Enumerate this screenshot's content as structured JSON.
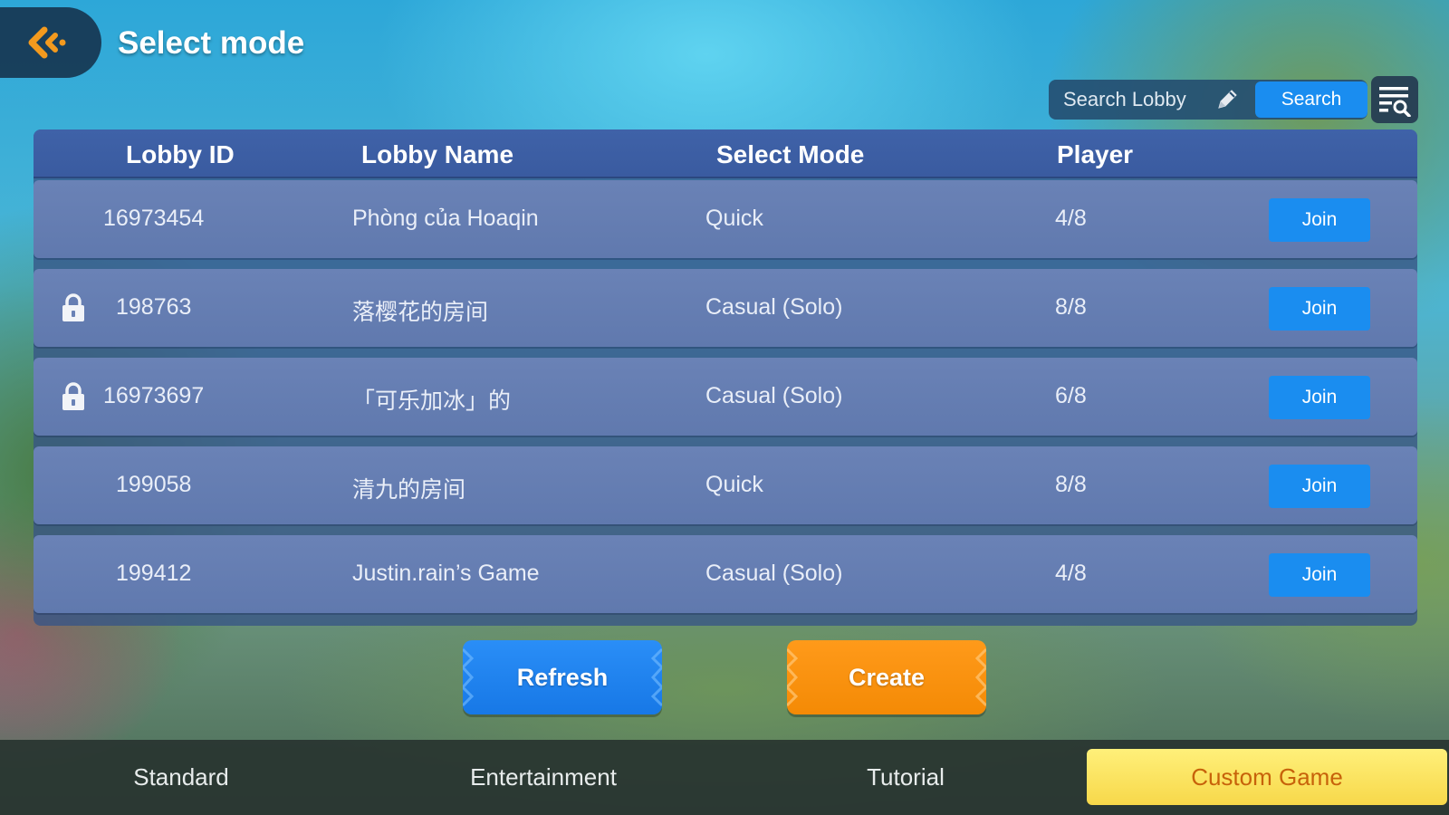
{
  "header": {
    "back_icon": "back-arrow-icon",
    "title": "Select mode"
  },
  "search": {
    "placeholder": "Search Lobby",
    "edit_icon": "pencil-icon",
    "button_label": "Search",
    "filter_icon": "list-search-icon"
  },
  "table": {
    "columns": [
      "Lobby ID",
      "Lobby Name",
      "Select Mode",
      "Player"
    ],
    "rows": [
      {
        "id": "16973454",
        "name": "Phòng của Hoaqin",
        "mode": "Quick",
        "players": "4/8",
        "locked": false,
        "join": "Join"
      },
      {
        "id": "198763",
        "name": "落樱花的房间",
        "mode": "Casual (Solo)",
        "players": "8/8",
        "locked": true,
        "join": "Join"
      },
      {
        "id": "16973697",
        "name": "「可乐加冰」的",
        "mode": "Casual (Solo)",
        "players": "6/8",
        "locked": true,
        "join": "Join"
      },
      {
        "id": "199058",
        "name": "清九的房间",
        "mode": "Quick",
        "players": "8/8",
        "locked": false,
        "join": "Join"
      },
      {
        "id": "199412",
        "name": "Justin.rain’s Game",
        "mode": "Casual (Solo)",
        "players": "4/8",
        "locked": false,
        "join": "Join"
      }
    ]
  },
  "actions": {
    "refresh_label": "Refresh",
    "create_label": "Create"
  },
  "nav": {
    "tabs": [
      "Standard",
      "Entertainment",
      "Tutorial",
      "Custom Game"
    ],
    "active_index": 3
  },
  "colors": {
    "accent_blue": "#1a8df0",
    "create_orange": "#f48a05",
    "active_tab_yellow": "#f7d84a",
    "active_tab_text": "#c7620a"
  }
}
